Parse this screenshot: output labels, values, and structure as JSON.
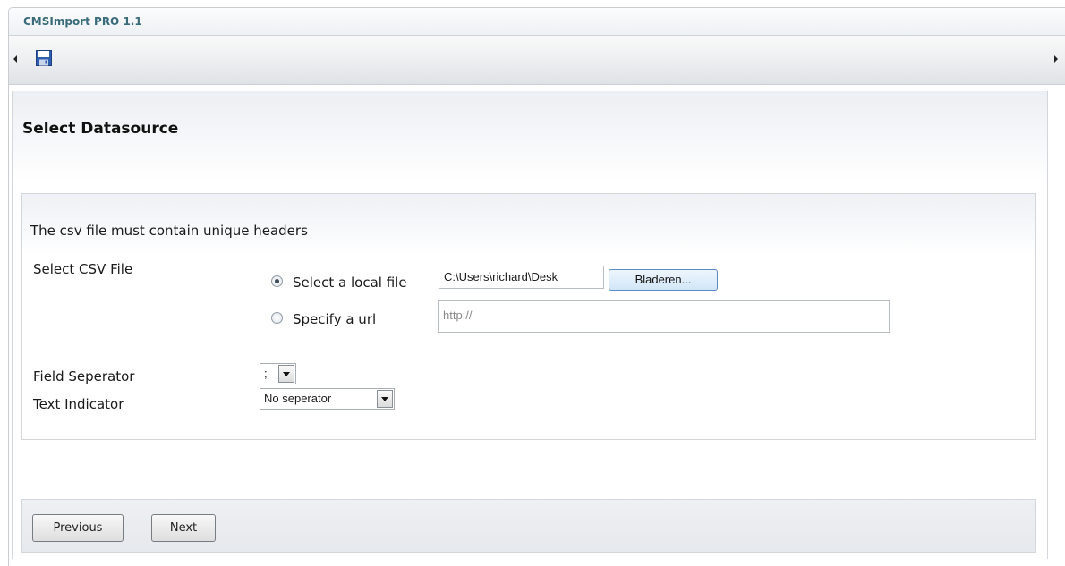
{
  "app": {
    "title": "CMSImport PRO 1.1"
  },
  "toolbar": {
    "save_icon": "floppy-disk-icon"
  },
  "page": {
    "title": "Select Datasource"
  },
  "form": {
    "notice": "The csv file must contain unique headers",
    "csv_label": "Select CSV File",
    "local_radio_label": "Select a local file",
    "local_file_value": "C:\\Users\\richard\\Desk",
    "browse_button": "Bladeren...",
    "url_radio_label": "Specify a url",
    "url_value": "http://",
    "field_separator_label": "Field Seperator",
    "field_separator_value": ";",
    "text_indicator_label": "Text Indicator",
    "text_indicator_value": "No seperator"
  },
  "footer": {
    "previous": "Previous",
    "next": "Next"
  }
}
